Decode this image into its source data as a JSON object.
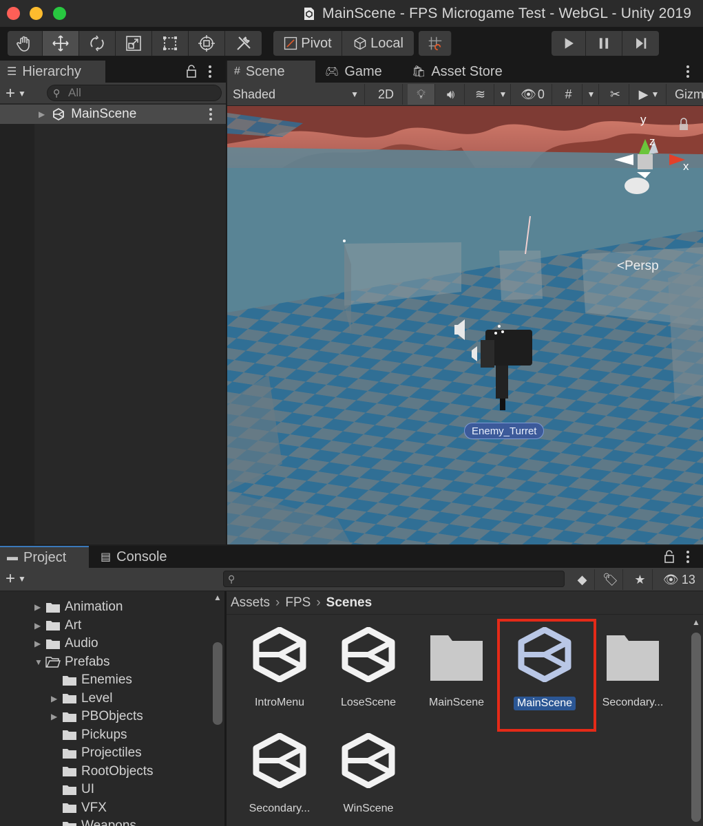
{
  "window": {
    "title": "MainScene - FPS Microgame Test - WebGL - Unity 2019"
  },
  "toolbar": {
    "pivot_label": "Pivot",
    "local_label": "Local",
    "tools": [
      "hand-tool-icon",
      "move-tool-icon",
      "rotate-tool-icon",
      "scale-tool-icon",
      "rect-tool-icon",
      "transform-tool-icon",
      "custom-tool-icon"
    ]
  },
  "hierarchy": {
    "tab_label": "Hierarchy",
    "search_placeholder": "All",
    "items": [
      {
        "label": "MainScene"
      }
    ]
  },
  "scene": {
    "tabs": [
      {
        "label": "Scene"
      },
      {
        "label": "Game"
      },
      {
        "label": "Asset Store"
      }
    ],
    "shading_mode": "Shaded",
    "mode_2d": "2D",
    "hidden_count": "0",
    "gizmos_label": "Gizm",
    "object_label": "Enemy_Turret",
    "persp_label": "Persp",
    "axis_y": "y",
    "axis_z": "z",
    "axis_x": "x"
  },
  "project": {
    "tabs": [
      {
        "label": "Project"
      },
      {
        "label": "Console"
      }
    ],
    "hidden_count": "13",
    "breadcrumb": [
      "Assets",
      "FPS",
      "Scenes"
    ],
    "tree": [
      {
        "label": "Animation",
        "indent": 1,
        "expanded": false
      },
      {
        "label": "Art",
        "indent": 1,
        "expanded": false
      },
      {
        "label": "Audio",
        "indent": 1,
        "expanded": false
      },
      {
        "label": "Prefabs",
        "indent": 1,
        "expanded": true
      },
      {
        "label": "Enemies",
        "indent": 2,
        "expanded": null
      },
      {
        "label": "Level",
        "indent": 2,
        "expanded": false
      },
      {
        "label": "PBObjects",
        "indent": 2,
        "expanded": false
      },
      {
        "label": "Pickups",
        "indent": 2,
        "expanded": null
      },
      {
        "label": "Projectiles",
        "indent": 2,
        "expanded": null
      },
      {
        "label": "RootObjects",
        "indent": 2,
        "expanded": null
      },
      {
        "label": "UI",
        "indent": 2,
        "expanded": null
      },
      {
        "label": "VFX",
        "indent": 2,
        "expanded": null
      },
      {
        "label": "Weapons",
        "indent": 2,
        "expanded": null
      }
    ],
    "assets": [
      {
        "label": "IntroMenu",
        "kind": "scene",
        "selected": false
      },
      {
        "label": "LoseScene",
        "kind": "scene",
        "selected": false
      },
      {
        "label": "MainScene",
        "kind": "folder",
        "selected": false
      },
      {
        "label": "MainScene",
        "kind": "scene",
        "selected": true
      },
      {
        "label": "Secondary...",
        "kind": "folder",
        "selected": false
      },
      {
        "label": "Secondary...",
        "kind": "scene",
        "selected": false
      },
      {
        "label": "WinScene",
        "kind": "scene",
        "selected": false
      }
    ]
  },
  "colors": {
    "selection": "#2b5694",
    "highlight": "#e42a18",
    "play_icon": "#c8c8c8"
  }
}
